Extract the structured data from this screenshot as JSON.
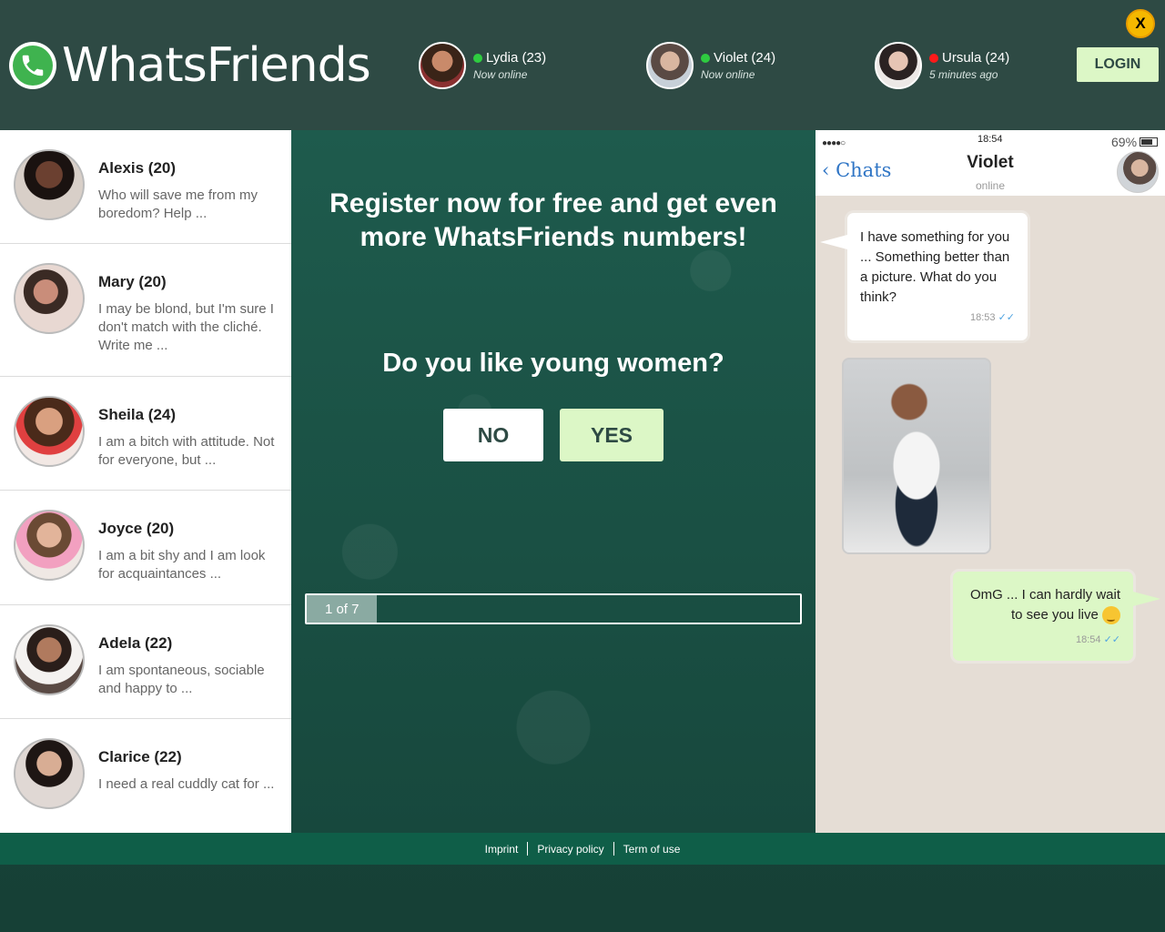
{
  "brand": {
    "name": "WhatsFriends"
  },
  "header": {
    "online_users": [
      {
        "name": "Lydia (23)",
        "status": "Now online",
        "status_color": "#2ecc40"
      },
      {
        "name": "Violet (24)",
        "status": "Now online",
        "status_color": "#2ecc40"
      },
      {
        "name": "Ursula (24)",
        "status": "5 minutes ago",
        "status_color": "#ff1a1a"
      }
    ],
    "login_label": "LOGIN",
    "close_label": "X"
  },
  "profiles": [
    {
      "name": "Alexis (20)",
      "text": "Who will save me from my boredom? Help ..."
    },
    {
      "name": "Mary (20)",
      "text": "I may be blond, but I'm sure I don't match with the cliché. Write me ..."
    },
    {
      "name": "Sheila (24)",
      "text": "I am a bitch with attitude. Not for everyone, but ..."
    },
    {
      "name": "Joyce (20)",
      "text": "I am a bit shy and I am look for acquaintances ..."
    },
    {
      "name": "Adela (22)",
      "text": "I am spontaneous, sociable and happy to ..."
    },
    {
      "name": "Clarice (22)",
      "text": "I need a real cuddly cat for ..."
    }
  ],
  "quiz": {
    "headline": "Register now for free and get even more WhatsFriends numbers!",
    "question": "Do you like young women?",
    "no_label": "NO",
    "yes_label": "YES",
    "progress_label": "1 of 7",
    "progress_fraction": 0.142857
  },
  "chat": {
    "signal": "●●●●○",
    "time": "18:54",
    "battery": "69%",
    "back_label": "Chats",
    "contact_name": "Violet",
    "contact_status": "online",
    "incoming_text": "I have something for you ... Something better than a picture. What do you think?",
    "incoming_time": "18:53",
    "outgoing_text": "OmG ... I can hardly wait to see you live",
    "outgoing_time": "18:54"
  },
  "footer": {
    "links": [
      "Imprint",
      "Privacy policy",
      "Term of use"
    ]
  },
  "colors": {
    "header_bg": "#2e4a44",
    "accent_green": "#dcf7c6",
    "footer_bg": "#0f5e48",
    "whatsapp_green": "#3fb34f"
  }
}
